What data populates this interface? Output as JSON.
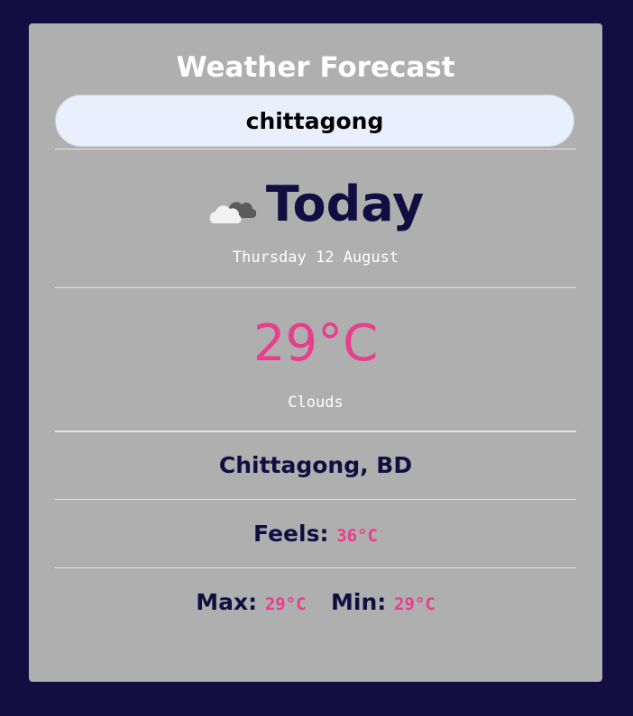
{
  "app": {
    "title": "Weather Forecast"
  },
  "search": {
    "value": "chittagong"
  },
  "today": {
    "icon": "cloud-icon",
    "label": "Today",
    "date": "Thursday 12 August"
  },
  "current": {
    "temperature": "29°C",
    "condition": "Clouds"
  },
  "location": {
    "name": "Chittagong, BD"
  },
  "details": {
    "feels_label": "Feels:",
    "feels_value": "36°C",
    "max_label": "Max:",
    "max_value": "29°C",
    "min_label": "Min:",
    "min_value": "29°C"
  },
  "colors": {
    "background": "#130e42",
    "card": "#afafaf",
    "accent": "#e83e8c",
    "heading": "#130e42",
    "input_bg": "#e8f0fe"
  }
}
